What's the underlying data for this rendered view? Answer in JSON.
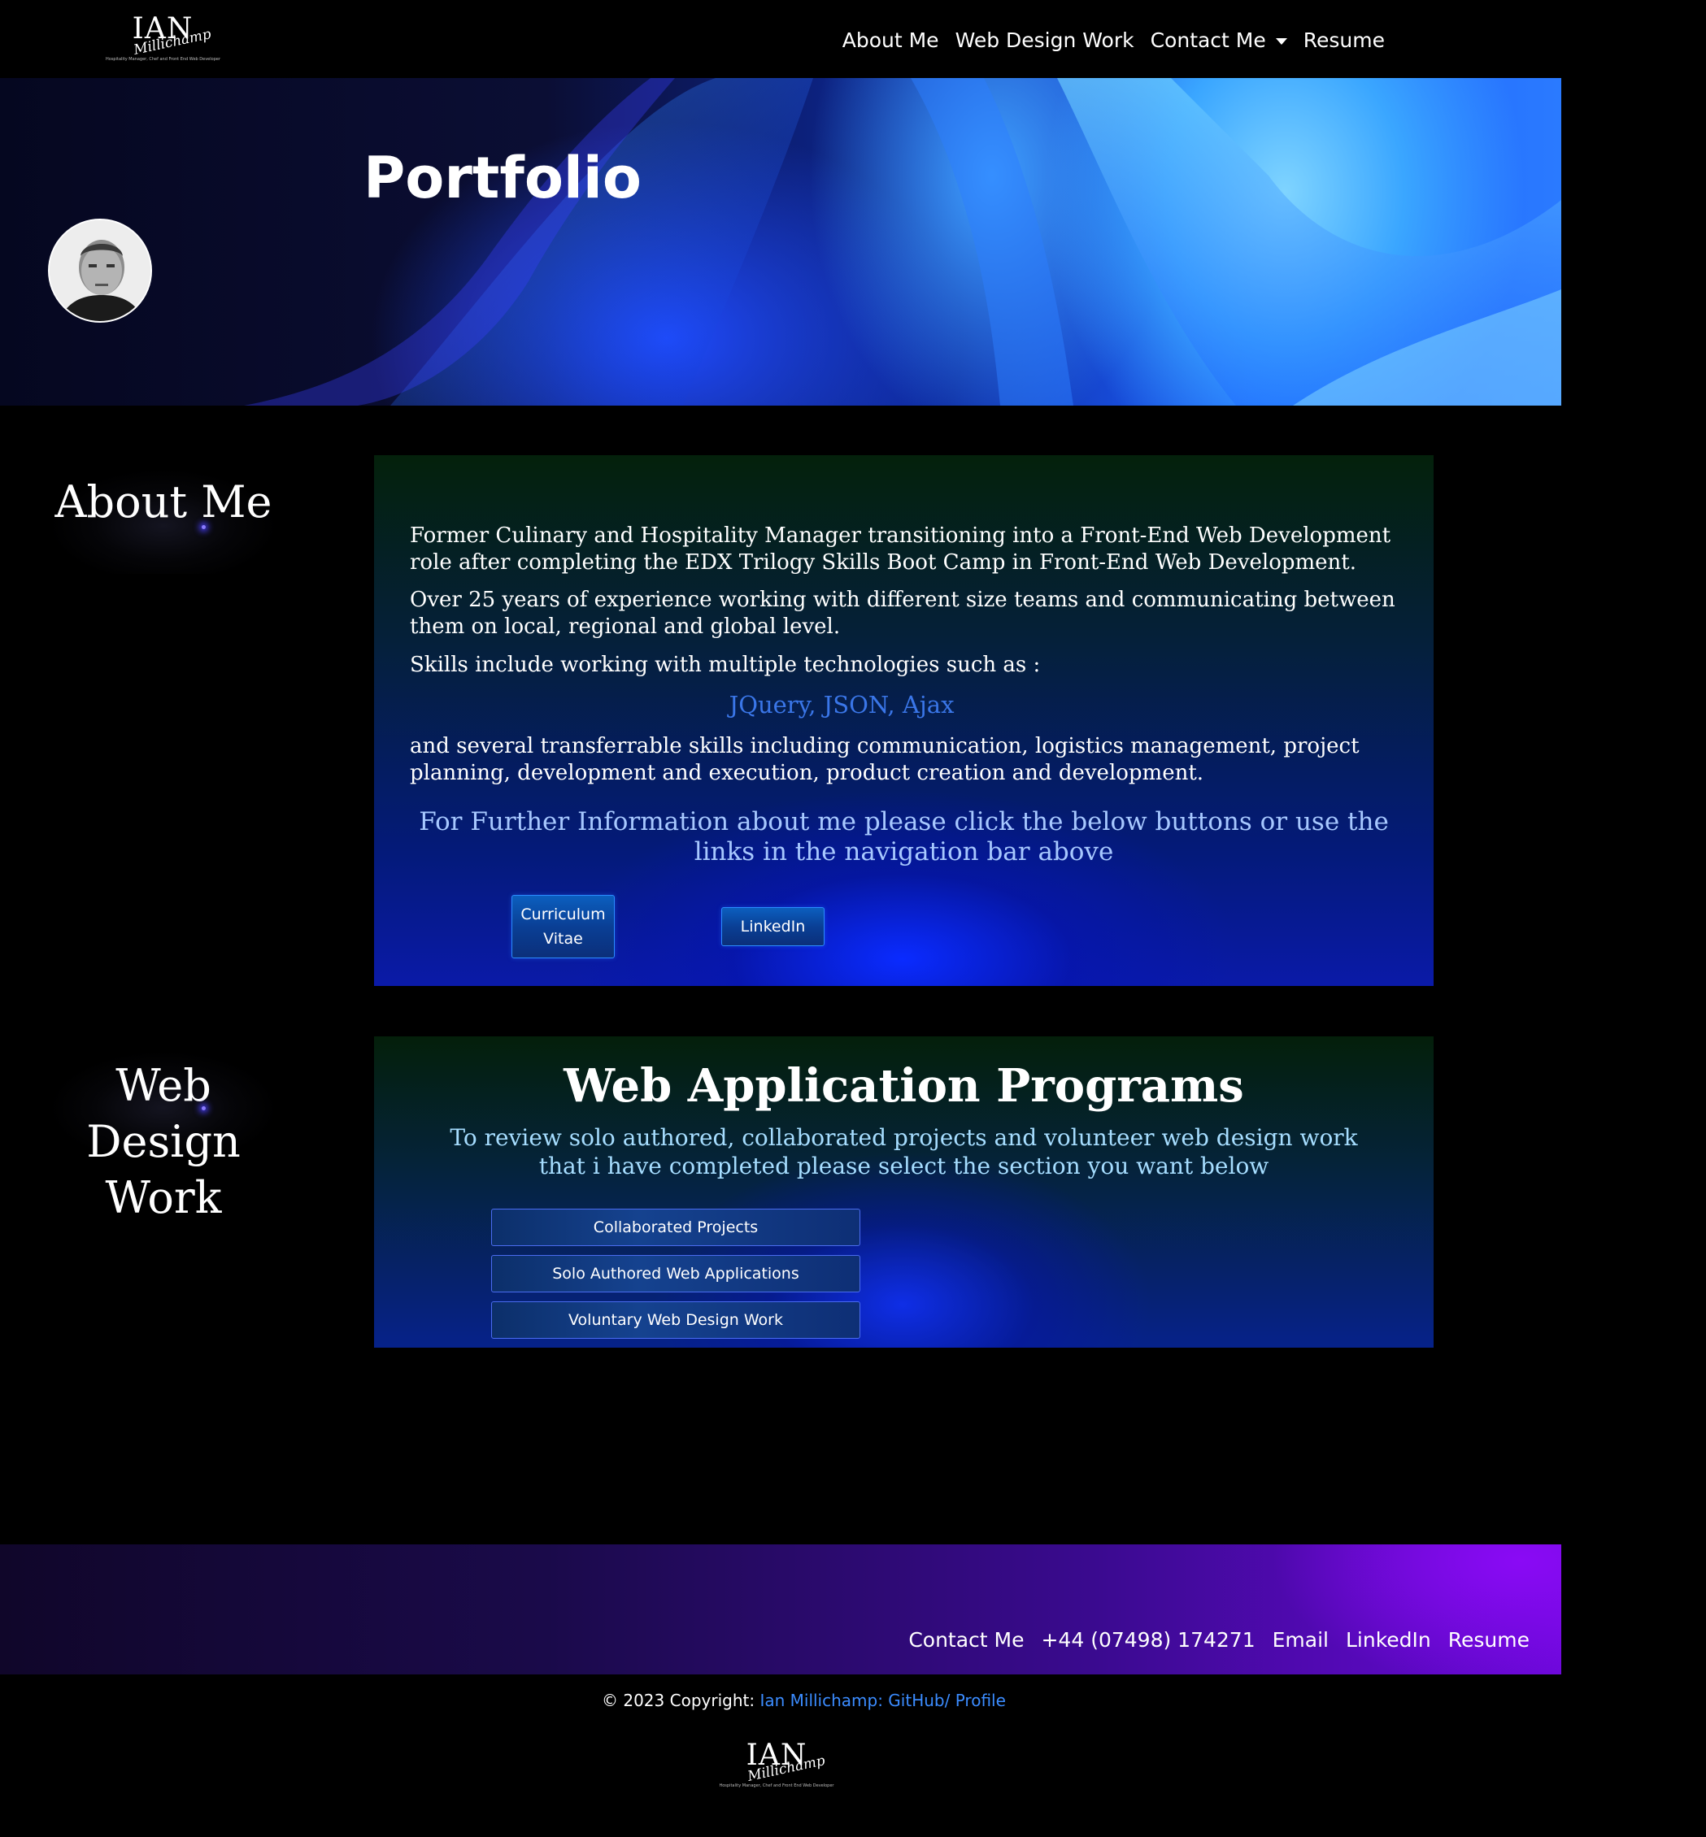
{
  "brand": {
    "name": "IAN",
    "script": "Millichamp",
    "tagline": "Hospitality Manager, Chef and Front End Web Developer"
  },
  "nav": {
    "items": [
      {
        "label": "About Me"
      },
      {
        "label": "Web Design Work"
      },
      {
        "label": "Contact Me"
      },
      {
        "label": "Resume"
      }
    ]
  },
  "hero": {
    "title": "Portfolio"
  },
  "about": {
    "label": "About Me",
    "paragraph1": "Former Culinary and Hospitality Manager transitioning into a Front-End Web Development role after completing the EDX Trilogy Skills Boot Camp in Front-End Web Development.",
    "paragraph2": "Over 25 years of experience working with different size teams and communicating between them on local, regional and global level.",
    "paragraph3": "Skills include working with multiple technologies such as :",
    "skills": "JQuery, JSON, Ajax",
    "paragraph4": "and several transferrable skills including communication, logistics management, project planning, development and execution, product creation and development.",
    "further": "For Further Information about me please click the below buttons or use the links in the navigation bar above",
    "cv_button": "Curriculum Vitae",
    "linkedin_button": "LinkedIn"
  },
  "web_work": {
    "label": "Web Design Work",
    "label_lines": [
      "Web",
      "Design",
      "Work"
    ],
    "title": "Web Application Programs",
    "subtitle": "To review solo authored, collaborated projects and volunteer web design work that i have completed please select the section you want below",
    "buttons": [
      "Collaborated Projects",
      "Solo Authored Web Applications",
      "Voluntary Web Design Work"
    ]
  },
  "footer": {
    "links": [
      "Contact Me",
      "+44 (07498) 174271",
      "Email",
      "LinkedIn",
      "Resume"
    ],
    "copyright_prefix": "© 2023 Copyright:",
    "copyright_link": "Ian Millichamp: GitHub/ Profile"
  },
  "colors": {
    "background": "#000000",
    "link_blue": "#3b8cff",
    "skills_blue": "#3a76e8",
    "footer_purple": "#6a08d8"
  },
  "icons": {
    "dropdown": "caret-down-icon",
    "avatar": "profile-photo"
  }
}
